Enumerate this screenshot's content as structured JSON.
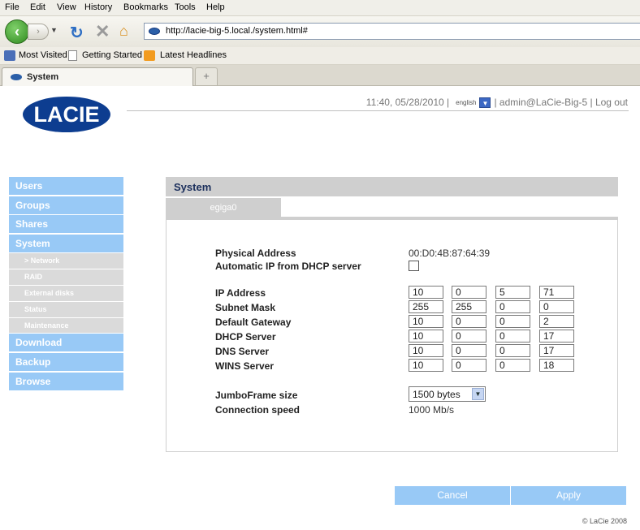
{
  "browser": {
    "menu": [
      "File",
      "Edit",
      "View",
      "History",
      "Bookmarks",
      "Tools",
      "Help"
    ],
    "url": "http://lacie-big-5.local./system.html#",
    "bookmarks": [
      "Most Visited",
      "Getting Started",
      "Latest Headlines"
    ],
    "tab_title": "System",
    "new_tab": "+"
  },
  "header": {
    "logo": "LACIE",
    "timestamp": "11:40, 05/28/2010 |",
    "language": "english",
    "user": "| admin@LaCie-Big-5 | Log out"
  },
  "sidebar": {
    "items": [
      {
        "label": "Users"
      },
      {
        "label": "Groups"
      },
      {
        "label": "Shares"
      },
      {
        "label": "System"
      }
    ],
    "subitems": [
      {
        "label": "> Network"
      },
      {
        "label": "RAID"
      },
      {
        "label": "External disks"
      },
      {
        "label": "Status"
      },
      {
        "label": "Maintenance"
      }
    ],
    "bottom_items": [
      {
        "label": "Download"
      },
      {
        "label": "Backup"
      },
      {
        "label": "Browse"
      }
    ]
  },
  "panel": {
    "title": "System",
    "tab": "egiga0",
    "physical_address_label": "Physical Address",
    "physical_address": "00:D0:4B:87:64:39",
    "dhcp_label": "Automatic IP from DHCP server",
    "dhcp_checked": false,
    "fields": [
      {
        "label": "IP Address",
        "octets": [
          "10",
          "0",
          "5",
          "71"
        ]
      },
      {
        "label": "Subnet Mask",
        "octets": [
          "255",
          "255",
          "0",
          "0"
        ]
      },
      {
        "label": "Default Gateway",
        "octets": [
          "10",
          "0",
          "0",
          "2"
        ]
      },
      {
        "label": "DHCP Server",
        "octets": [
          "10",
          "0",
          "0",
          "17"
        ]
      },
      {
        "label": "DNS Server",
        "octets": [
          "10",
          "0",
          "0",
          "17"
        ]
      },
      {
        "label": "WINS Server",
        "octets": [
          "10",
          "0",
          "0",
          "18"
        ]
      }
    ],
    "jumbo_label": "JumboFrame size",
    "jumbo_value": "1500 bytes",
    "speed_label": "Connection speed",
    "speed_value": "1000 Mb/s"
  },
  "actions": {
    "cancel": "Cancel",
    "apply": "Apply"
  },
  "footer": {
    "copyright": "© LaCie 2008"
  }
}
